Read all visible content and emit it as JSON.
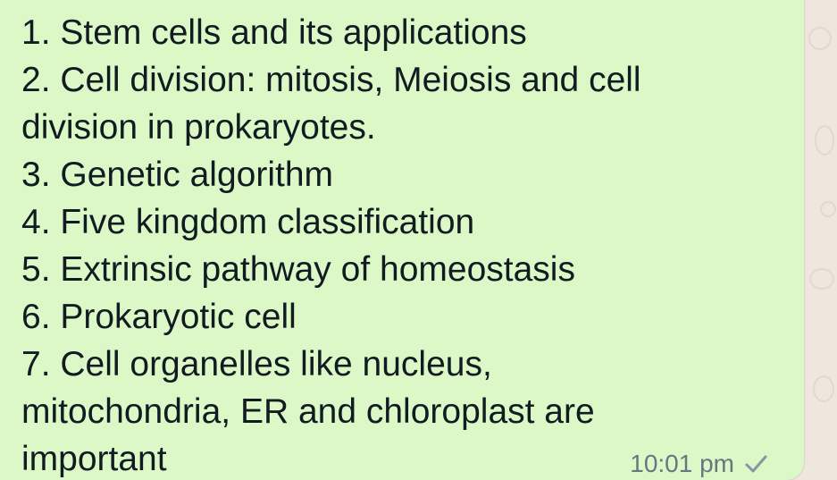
{
  "message": {
    "lines": [
      "1. Stem cells and its applications",
      "2. Cell division: mitosis, Meiosis and cell",
      "division in prokaryotes.",
      "3. Genetic algorithm",
      "4. Five kingdom classification",
      "5. Extrinsic pathway of homeostasis",
      "6. Prokaryotic cell",
      "7. Cell organelles like nucleus,",
      "mitochondria, ER  and chloroplast are",
      "important"
    ],
    "timestamp": "10:01 pm",
    "status_icon": "single-check-icon"
  },
  "colors": {
    "bubble": "#dcf8c6",
    "wallpaper": "#efe7de",
    "text": "#111b21",
    "timestamp": "#667781",
    "tick": "#8696a0"
  }
}
